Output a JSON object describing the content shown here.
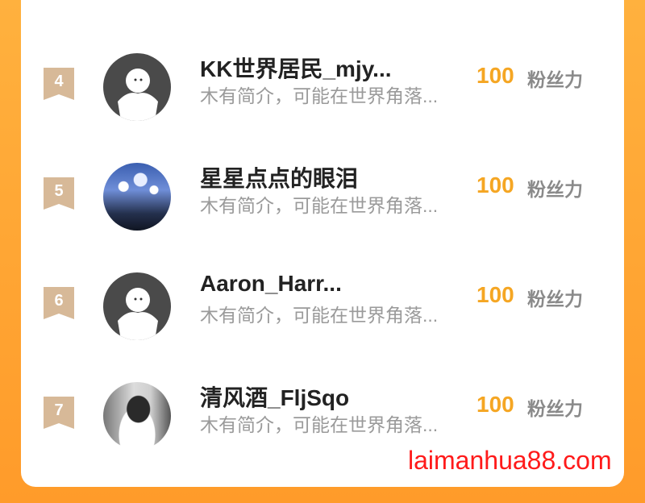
{
  "ranking": {
    "fans_label": "粉丝力",
    "rows": [
      {
        "rank": "4",
        "username": "KK世界居民_mjy...",
        "bio": "木有简介，可能在世界角落...",
        "fans": "100",
        "avatar": "default-avatar"
      },
      {
        "rank": "5",
        "username": "星星点点的眼泪",
        "bio": "木有简介，可能在世界角落...",
        "fans": "100",
        "avatar": "landscape-photo"
      },
      {
        "rank": "6",
        "username": "Aaron_Harr...",
        "bio": "木有简介，可能在世界角落...",
        "fans": "100",
        "avatar": "default-avatar"
      },
      {
        "rank": "7",
        "username": "清风酒_FljSqo",
        "bio": "木有简介，可能在世界角落...",
        "fans": "100",
        "avatar": "portrait-photo"
      }
    ]
  },
  "watermark": "laimanhua88.com",
  "colors": {
    "background": "#ff9b2a",
    "card": "#ffffff",
    "fans_number": "#f5a623",
    "rank_badge": "#d7b998",
    "watermark": "#ff1a1a"
  }
}
